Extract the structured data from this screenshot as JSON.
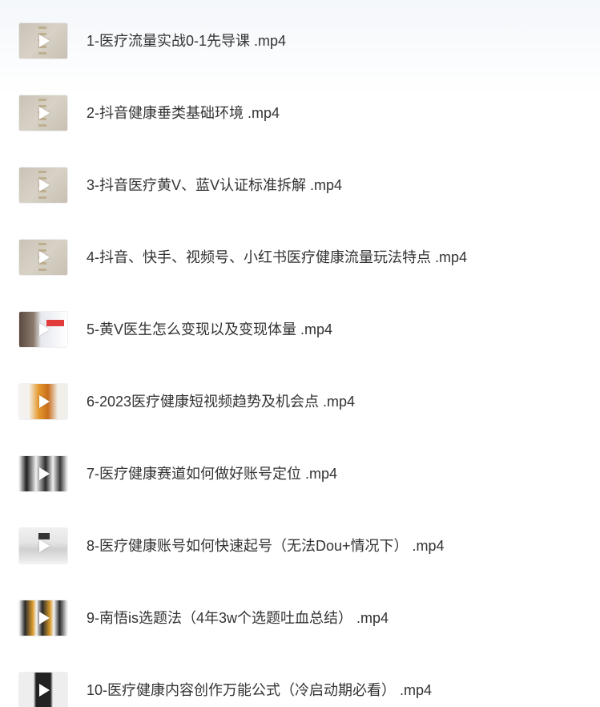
{
  "files": [
    {
      "name": "1-医疗流量实战0-1先导课 .mp4",
      "thumbnail": "beige-title-card"
    },
    {
      "name": "2-抖音健康垂类基础环境 .mp4",
      "thumbnail": "beige-title-card"
    },
    {
      "name": "3-抖音医疗黄V、蓝V认证标准拆解 .mp4",
      "thumbnail": "beige-title-card"
    },
    {
      "name": "4-抖音、快手、视频号、小红书医疗健康流量玩法特点 .mp4",
      "thumbnail": "beige-title-card"
    },
    {
      "name": "5-黄V医生怎么变现以及变现体量 .mp4",
      "thumbnail": "doctor-slide"
    },
    {
      "name": "6-2023医疗健康短视频趋势及机会点 .mp4",
      "thumbnail": "orange-slide"
    },
    {
      "name": "7-医疗健康赛道如何做好账号定位 .mp4",
      "thumbnail": "phones-slide"
    },
    {
      "name": "8-医疗健康账号如何快速起号（无法Dou+情况下） .mp4",
      "thumbnail": "screenshot-slide"
    },
    {
      "name": "9-南悟is选题法（4年3w个选题吐血总结） .mp4",
      "thumbnail": "cards-slide"
    },
    {
      "name": "10-医疗健康内容创作万能公式（冷启动期必看） .mp4",
      "thumbnail": "book-slide"
    }
  ]
}
